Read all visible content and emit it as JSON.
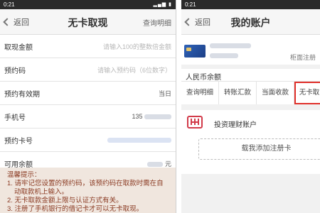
{
  "left": {
    "status_time": "0:21",
    "back_label": "返回",
    "title": "无卡取现",
    "right_action": "查询明细",
    "rows": [
      {
        "label": "取现金额",
        "value": "请输入100的整数倍金额"
      },
      {
        "label": "预约码",
        "value": "请输入预约码（6位数字）"
      },
      {
        "label": "预约有效期",
        "value": "当日"
      },
      {
        "label": "手机号",
        "value": "135"
      },
      {
        "label": "预约卡号",
        "value": ""
      },
      {
        "label": "可用余额",
        "value": "元"
      }
    ],
    "tips": {
      "title": "温馨提示：",
      "line1": "1. 请牢记您设置的预约码，该预约码在取款时需在自",
      "line2": "动取款机上输入。",
      "line3": "2. 无卡取款金额上限与认证方式有关。",
      "line4": "3. 注册了手机银行的借记卡才可以无卡取现。"
    }
  },
  "right": {
    "status_time": "0:21",
    "back_label": "返回",
    "title": "我的账户",
    "account_status": "柜面注册",
    "balance_label": "人民币余额",
    "quick_actions": [
      "查询明细",
      "转账汇款",
      "当面收款",
      "无卡取"
    ],
    "invest_label": "投资理财账户",
    "add_card_label": "载我添加注册卡"
  },
  "colors": {
    "highlight_border": "#e0302a",
    "tips_text": "#8a3a22",
    "tips_bg": "#f0e6de"
  }
}
